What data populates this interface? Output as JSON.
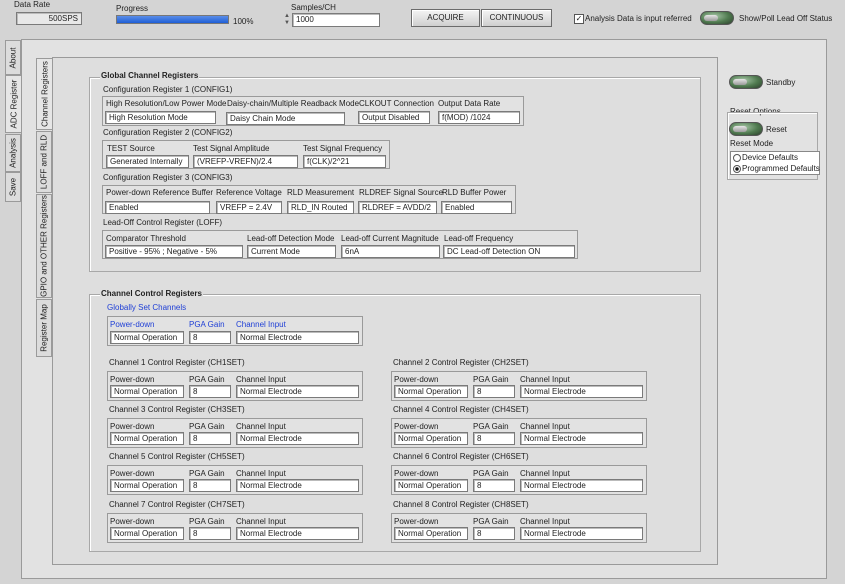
{
  "toolbar": {
    "data_rate_label": "Data Rate",
    "data_rate_value": "500SPS",
    "progress_label": "Progress",
    "progress_value": 1.0,
    "progress_text": "100%",
    "samples_label": "Samples/CH",
    "samples_value": "1000",
    "acquire": "ACQUIRE",
    "continuous": "CONTINUOUS",
    "referred_label": "Analysis Data is input referred",
    "lead_off_label": "Show/Poll Lead Off Status"
  },
  "outer_tabs": [
    "About",
    "ADC Register",
    "Analysis",
    "Save"
  ],
  "inner_tabs": [
    "Channel Registers",
    "LOFF and RLD",
    "GPIO and OTHER Registers",
    "Register Map"
  ],
  "global": {
    "title": "Global Channel Registers",
    "config1": {
      "title": "Configuration Register 1 (CONFIG1)",
      "labels": [
        "High Resolution/Low Power Mode",
        "Daisy-chain/Multiple Readback Mode",
        "CLKOUT Connection",
        "Output Data Rate"
      ],
      "values": [
        "High Resolution Mode",
        "Daisy Chain Mode",
        "Output Disabled",
        "f(MOD) /1024"
      ]
    },
    "config2": {
      "title": "Configuration Register 2 (CONFIG2)",
      "labels": [
        "TEST Source",
        "Test Signal Amplitude",
        "Test Signal Frequency"
      ],
      "values": [
        "Generated Internally",
        "(VREFP-VREFN)/2.4",
        "f(CLK)/2^21"
      ]
    },
    "config3": {
      "title": "Configuration Register 3 (CONFIG3)",
      "labels": [
        "Power-down Reference Buffer",
        "Reference Voltage",
        "RLD Measurement",
        "RLDREF Signal Source",
        "RLD Buffer Power"
      ],
      "values": [
        "Enabled",
        "VREFP = 2.4V",
        "RLD_IN Routed",
        "RLDREF = AVDD/2",
        "Enabled"
      ]
    },
    "loff": {
      "title": "Lead-Off Control Register (LOFF)",
      "labels": [
        "Comparator Threshold",
        "Lead-off Detection Mode",
        "Lead-off Current Magnitude",
        "Lead-off Frequency"
      ],
      "values": [
        "Positive - 95% ; Negative - 5%",
        "Current Mode",
        "6nA",
        "DC Lead-off Detection ON"
      ]
    }
  },
  "channel": {
    "title": "Channel Control Registers",
    "global_set_title": "Globally Set Channels",
    "col_labels": [
      "Power-down",
      "PGA Gain",
      "Channel Input"
    ],
    "global_values": [
      "Normal Operation",
      "8",
      "Normal Electrode"
    ],
    "channels": [
      {
        "title": "Channel 1 Control Register (CH1SET)",
        "values": [
          "Normal Operation",
          "8",
          "Normal Electrode"
        ]
      },
      {
        "title": "Channel 2 Control Register (CH2SET)",
        "values": [
          "Normal Operation",
          "8",
          "Normal Electrode"
        ]
      },
      {
        "title": "Channel 3 Control Register (CH3SET)",
        "values": [
          "Normal Operation",
          "8",
          "Normal Electrode"
        ]
      },
      {
        "title": "Channel 4 Control Register (CH4SET)",
        "values": [
          "Normal Operation",
          "8",
          "Normal Electrode"
        ]
      },
      {
        "title": "Channel 5 Control Register (CH5SET)",
        "values": [
          "Normal Operation",
          "8",
          "Normal Electrode"
        ]
      },
      {
        "title": "Channel 6 Control Register (CH6SET)",
        "values": [
          "Normal Operation",
          "8",
          "Normal Electrode"
        ]
      },
      {
        "title": "Channel 7 Control Register (CH7SET)",
        "values": [
          "Normal Operation",
          "8",
          "Normal Electrode"
        ]
      },
      {
        "title": "Channel 8 Control Register (CH8SET)",
        "values": [
          "Normal Operation",
          "8",
          "Normal Electrode"
        ]
      }
    ]
  },
  "side": {
    "standby": "Standby",
    "reset_options": "Reset Options",
    "reset": "Reset",
    "reset_mode": "Reset Mode",
    "modes": [
      "Device Defaults",
      "Programmed Defaults"
    ],
    "selected_mode": "Programmed Defaults"
  },
  "colors": {
    "progress": "#1f5fd6",
    "group_title_blue": "#1f3fd6"
  }
}
